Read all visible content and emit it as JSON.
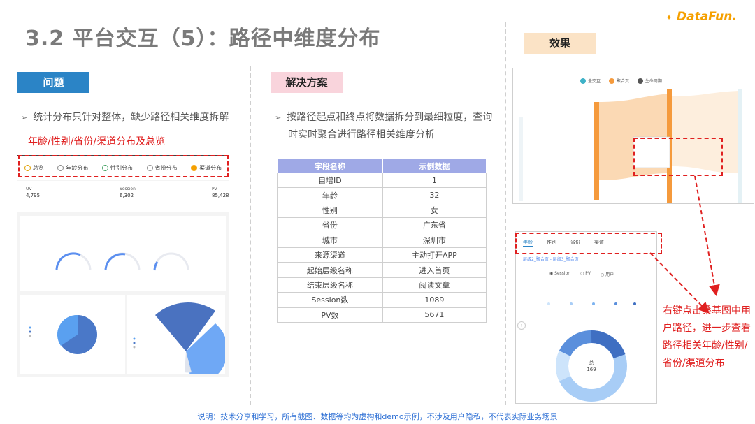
{
  "title": "3.2 平台交互（5）：路径中维度分布",
  "logo": {
    "text": "DataFun."
  },
  "sections": {
    "problem": {
      "tag": "问题",
      "bullet": "统计分布只针对整体，缺少路径相关维度拆解",
      "note": "年龄/性别/省份/渠道分布及总览"
    },
    "solution": {
      "tag": "解决方案",
      "bullet_line1": "按路径起点和终点将数据拆分到最细粒度，查询",
      "bullet_line2": "时实时聚合进行路径相关维度分析"
    },
    "effect": {
      "tag": "效果",
      "note_lines": [
        "右键点击桑基图中用",
        "户路径，进一步查看",
        "路径相关年龄/性别/",
        "省份/渠道分布"
      ]
    }
  },
  "dashboard": {
    "tabs": [
      "总览",
      "年龄分布",
      "性别分布",
      "省份分布",
      "渠道分布"
    ],
    "stats": [
      {
        "label": "UV",
        "value": "4,795"
      },
      {
        "label": "Session",
        "value": "6,302"
      },
      {
        "label": "PV",
        "value": "85,428"
      }
    ]
  },
  "field_table": {
    "headers": [
      "字段名称",
      "示例数据"
    ],
    "rows": [
      [
        "自增ID",
        "1"
      ],
      [
        "年龄",
        "32"
      ],
      [
        "性别",
        "女"
      ],
      [
        "省份",
        "广东省"
      ],
      [
        "城市",
        "深圳市"
      ],
      [
        "来源渠道",
        "主动打开APP"
      ],
      [
        "起始层级名称",
        "进入首页"
      ],
      [
        "结束层级名称",
        "阅读文章"
      ],
      [
        "Session数",
        "1089"
      ],
      [
        "PV数",
        "5671"
      ]
    ]
  },
  "sankey": {
    "legend": [
      "全交互",
      "聚合页",
      "生命周期"
    ],
    "colors": {
      "teal": "#3fb2c8",
      "orange": "#f59a3c",
      "band": "#fbd9b4",
      "dark": "#555555"
    }
  },
  "sub_shot": {
    "tabs": [
      "年龄",
      "性别",
      "省份",
      "渠道"
    ],
    "breadcrumb": "层级2_聚合页 - 层级3_聚合页",
    "radios": [
      "Session",
      "PV",
      "用户"
    ],
    "donut": {
      "center_label": "总",
      "center_value": "169"
    }
  },
  "footer": "说明：技术分享和学习，所有截图、数据等均为虚构和demo示例，不涉及用户隐私，不代表实际业务场景"
}
